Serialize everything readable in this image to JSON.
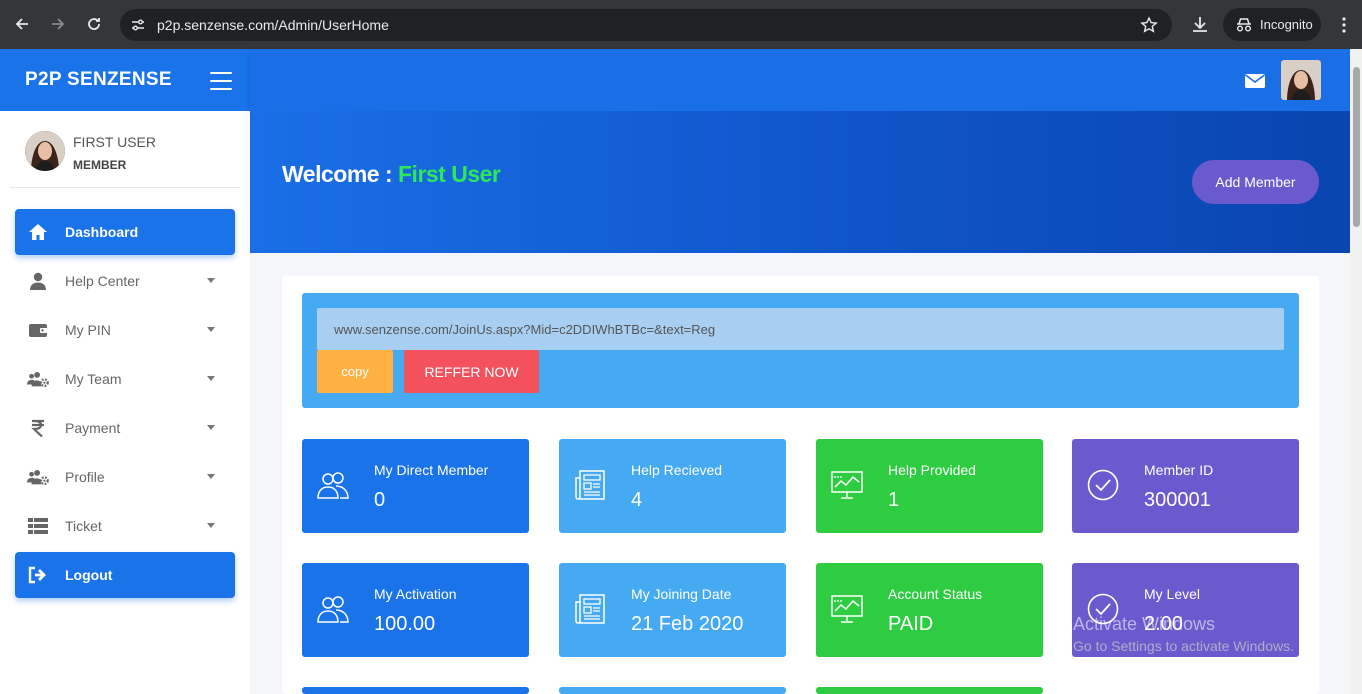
{
  "browser": {
    "url": "p2p.senzense.com/Admin/UserHome",
    "profile_label": "Incognito"
  },
  "sidebar": {
    "brand": "P2P SENZENSE",
    "user": {
      "name": "FIRST USER",
      "role": "MEMBER"
    },
    "items": [
      {
        "label": "Dashboard",
        "icon": "home-icon",
        "active": true,
        "has_dropdown": false
      },
      {
        "label": "Help Center",
        "icon": "user-icon",
        "active": false,
        "has_dropdown": true
      },
      {
        "label": "My PIN",
        "icon": "wallet-icon",
        "active": false,
        "has_dropdown": true
      },
      {
        "label": "My Team",
        "icon": "users-cog-icon",
        "active": false,
        "has_dropdown": true
      },
      {
        "label": "Payment",
        "icon": "rupee-icon",
        "active": false,
        "has_dropdown": true
      },
      {
        "label": "Profile",
        "icon": "users-cog-icon",
        "active": false,
        "has_dropdown": true
      },
      {
        "label": "Ticket",
        "icon": "table-icon",
        "active": false,
        "has_dropdown": true
      },
      {
        "label": "Logout",
        "icon": "logout-icon",
        "active": true,
        "has_dropdown": false
      }
    ]
  },
  "header": {
    "welcome_prefix": "Welcome :",
    "welcome_name": "First User",
    "add_member_label": "Add Member"
  },
  "referral": {
    "link": "www.senzense.com/JoinUs.aspx?Mid=c2DDIWhBTBc=&text=Reg",
    "copy_label": "copy",
    "refer_label": "REFFER NOW"
  },
  "stats": [
    {
      "label": "My Direct Member",
      "value": "0",
      "color": "#1a73e8",
      "icon": "users-icon"
    },
    {
      "label": "Help Recieved",
      "value": "4",
      "color": "#45aaf2",
      "icon": "newspaper-icon"
    },
    {
      "label": "Help Provided",
      "value": "1",
      "color": "#2ecc40",
      "icon": "monitor-chart-icon"
    },
    {
      "label": "Member ID",
      "value": "300001",
      "color": "#6a5acd",
      "icon": "check-circle-icon"
    },
    {
      "label": "My Activation",
      "value": "100.00",
      "color": "#1a73e8",
      "icon": "users-icon"
    },
    {
      "label": "My Joining Date",
      "value": "21 Feb 2020",
      "color": "#45aaf2",
      "icon": "newspaper-icon"
    },
    {
      "label": "Account Status",
      "value": "PAID",
      "color": "#2ecc40",
      "icon": "monitor-chart-icon"
    },
    {
      "label": "My Level",
      "value": "2.00",
      "color": "#6a5acd",
      "icon": "check-circle-icon"
    }
  ],
  "watermark": {
    "line1": "Activate Windows",
    "line2": "Go to Settings to activate Windows."
  }
}
